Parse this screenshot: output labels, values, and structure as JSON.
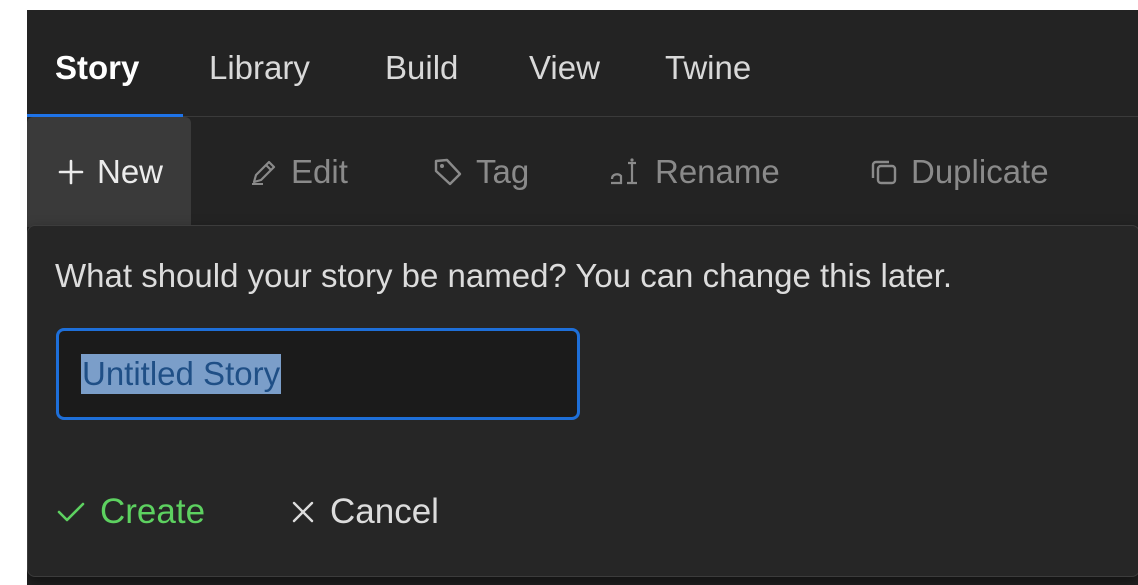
{
  "tabs": [
    {
      "label": "Story",
      "active": true
    },
    {
      "label": "Library"
    },
    {
      "label": "Build"
    },
    {
      "label": "View"
    },
    {
      "label": "Twine"
    }
  ],
  "toolbar": {
    "new": {
      "label": "New",
      "icon": "plus-icon"
    },
    "edit": {
      "label": "Edit",
      "icon": "pencil-icon"
    },
    "tag": {
      "label": "Tag",
      "icon": "tag-icon"
    },
    "rename": {
      "label": "Rename",
      "icon": "rename-icon"
    },
    "duplicate": {
      "label": "Duplicate",
      "icon": "duplicate-icon"
    }
  },
  "dialog": {
    "prompt": "What should your story be named? You can change this later.",
    "input_value": "Untitled Story",
    "create_label": "Create",
    "cancel_label": "Cancel"
  },
  "colors": {
    "accent": "#1e73e8",
    "create": "#5dd160",
    "background": "#232323"
  }
}
